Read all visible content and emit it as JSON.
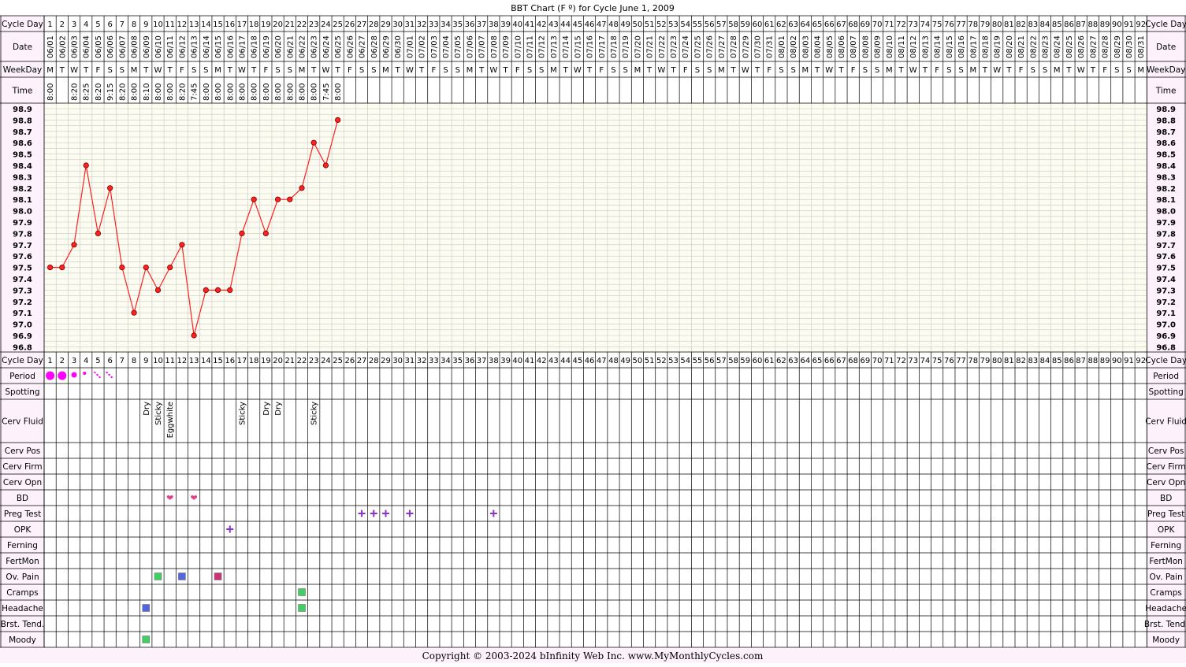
{
  "title": "BBT Chart (F º) for Cycle June 1, 2009",
  "footer": "Copyright © 2003-2024 bInfinity Web Inc.     www.MyMonthlyCycles.com",
  "colors": {
    "page_bg": "#ffffff",
    "label_bg": "#fdf2fc",
    "grid_bg": "#fcfcf0",
    "grid_line": "#c8c8c8",
    "grid_dark": "#000000",
    "temp_line": "#ff2020",
    "temp_point": "#ff2020",
    "period": "#ff00ff",
    "heart": "#e0408a",
    "plus": "#8a33cc",
    "sq_green": "#44cc66",
    "sq_blue": "#5566dd",
    "sq_magenta": "#cc3377"
  },
  "row_labels": {
    "cycle_day": "Cycle Day",
    "date": "Date",
    "weekday": "WeekDay",
    "time": "Time",
    "period": "Period",
    "spotting": "Spotting",
    "cerv_fluid": "Cerv Fluid",
    "cerv_pos": "Cerv Pos",
    "cerv_firm": "Cerv Firm",
    "cerv_opn": "Cerv Opn",
    "bd": "BD",
    "preg_test": "Preg Test",
    "opk": "OPK",
    "ferning": "Ferning",
    "fertmon": "FertMon",
    "ov_pain": "Ov. Pain",
    "cramps": "Cramps",
    "headache": "Headache",
    "brst_tend": "Brst. Tend.",
    "moody": "Moody"
  },
  "days": 92,
  "dates": [
    "06/01",
    "06/02",
    "06/03",
    "06/04",
    "06/05",
    "06/06",
    "06/07",
    "06/08",
    "06/09",
    "06/10",
    "06/11",
    "06/12",
    "06/13",
    "06/14",
    "06/15",
    "06/16",
    "06/17",
    "06/18",
    "06/19",
    "06/20",
    "06/21",
    "06/22",
    "06/23",
    "06/24",
    "06/25",
    "06/26",
    "06/27",
    "06/28",
    "06/29",
    "06/30",
    "07/01",
    "07/02",
    "07/03",
    "07/04",
    "07/05",
    "07/06",
    "07/07",
    "07/08",
    "07/09",
    "07/10",
    "07/11",
    "07/12",
    "07/13",
    "07/14",
    "07/15",
    "07/16",
    "07/17",
    "07/18",
    "07/19",
    "07/20",
    "07/21",
    "07/22",
    "07/23",
    "07/24",
    "07/25",
    "07/26",
    "07/27",
    "07/28",
    "07/29",
    "07/30",
    "07/31",
    "08/01",
    "08/02",
    "08/03",
    "08/04",
    "08/05",
    "08/06",
    "08/07",
    "08/08",
    "08/09",
    "08/10",
    "08/11",
    "08/12",
    "08/13",
    "08/14",
    "08/15",
    "08/16",
    "08/17",
    "08/18",
    "08/19",
    "08/20",
    "08/21",
    "08/22",
    "08/23",
    "08/24",
    "08/25",
    "08/26",
    "08/27",
    "08/28",
    "08/29",
    "08/30",
    "08/31"
  ],
  "weekdays": [
    "M",
    "T",
    "W",
    "T",
    "F",
    "S",
    "S",
    "M",
    "T",
    "W",
    "T",
    "F",
    "S",
    "S",
    "M",
    "T",
    "W",
    "T",
    "F",
    "S",
    "S",
    "M",
    "T",
    "W",
    "T",
    "F",
    "S",
    "S",
    "M",
    "T",
    "W",
    "T",
    "F",
    "S",
    "S",
    "M",
    "T",
    "W",
    "T",
    "F",
    "S",
    "S",
    "M",
    "T",
    "W",
    "T",
    "F",
    "S",
    "S",
    "M",
    "T",
    "W",
    "T",
    "F",
    "S",
    "S",
    "M",
    "T",
    "W",
    "T",
    "F",
    "S",
    "S",
    "M",
    "T",
    "W",
    "T",
    "F",
    "S",
    "S",
    "M",
    "T",
    "W",
    "T",
    "F",
    "S",
    "S",
    "M",
    "T",
    "W",
    "T",
    "F",
    "S",
    "S",
    "M",
    "T",
    "W",
    "T",
    "F",
    "S",
    "S",
    "M"
  ],
  "times": [
    "8:00",
    "",
    "8:20",
    "8:25",
    "8:20",
    "9:15",
    "8:20",
    "8:00",
    "8:10",
    "8:00",
    "8:00",
    "8:20",
    "7:45",
    "8:00",
    "8:00",
    "8:00",
    "8:00",
    "8:00",
    "8:00",
    "8:00",
    "8:00",
    "8:00",
    "8:00",
    "7:45",
    "8:00"
  ],
  "chart_data": {
    "type": "line",
    "x_label": "Cycle Day",
    "ylim": [
      96.8,
      98.9
    ],
    "y_ticks": [
      "98.9",
      "98.8",
      "98.7",
      "98.6",
      "98.5",
      "98.4",
      "98.3",
      "98.2",
      "98.1",
      "98.0",
      "97.9",
      "97.8",
      "97.7",
      "97.6",
      "97.5",
      "97.4",
      "97.3",
      "97.2",
      "97.1",
      "97.0",
      "96.9",
      "96.8"
    ],
    "series": [
      {
        "x": [
          1,
          2,
          3,
          4,
          5,
          6,
          7,
          8,
          9,
          10,
          11,
          12,
          13,
          14,
          15,
          16,
          17,
          18,
          19,
          20,
          21,
          22,
          23,
          24,
          25
        ],
        "values": [
          97.5,
          97.5,
          97.7,
          98.4,
          97.8,
          98.2,
          97.5,
          97.1,
          97.5,
          97.3,
          97.5,
          97.7,
          96.9,
          97.3,
          97.3,
          97.3,
          97.8,
          98.1,
          97.8,
          98.1,
          98.1,
          98.2,
          98.6,
          98.4,
          98.8
        ]
      }
    ],
    "grid": true
  },
  "observations": {
    "period": [
      {
        "day": 1,
        "level": "heavy"
      },
      {
        "day": 2,
        "level": "heavy"
      },
      {
        "day": 3,
        "level": "medium"
      },
      {
        "day": 4,
        "level": "light"
      },
      {
        "day": 5,
        "level": "spotting"
      },
      {
        "day": 6,
        "level": "spotting"
      }
    ],
    "cerv_fluid": [
      {
        "day": 9,
        "text": "Dry"
      },
      {
        "day": 10,
        "text": "Sticky"
      },
      {
        "day": 11,
        "text": "Eggwhite"
      },
      {
        "day": 17,
        "text": "Sticky"
      },
      {
        "day": 19,
        "text": "Dry"
      },
      {
        "day": 20,
        "text": "Dry"
      },
      {
        "day": 23,
        "text": "Sticky"
      }
    ],
    "bd": [
      11,
      13
    ],
    "preg_test": [
      27,
      28,
      29,
      31,
      38
    ],
    "opk": [
      16
    ],
    "ov_pain": [
      {
        "day": 10,
        "color": "green"
      },
      {
        "day": 12,
        "color": "blue"
      },
      {
        "day": 15,
        "color": "magenta"
      }
    ],
    "cramps": [
      {
        "day": 22,
        "color": "green"
      }
    ],
    "headache": [
      {
        "day": 9,
        "color": "blue"
      },
      {
        "day": 22,
        "color": "green"
      }
    ],
    "moody": [
      {
        "day": 9,
        "color": "green"
      }
    ]
  }
}
